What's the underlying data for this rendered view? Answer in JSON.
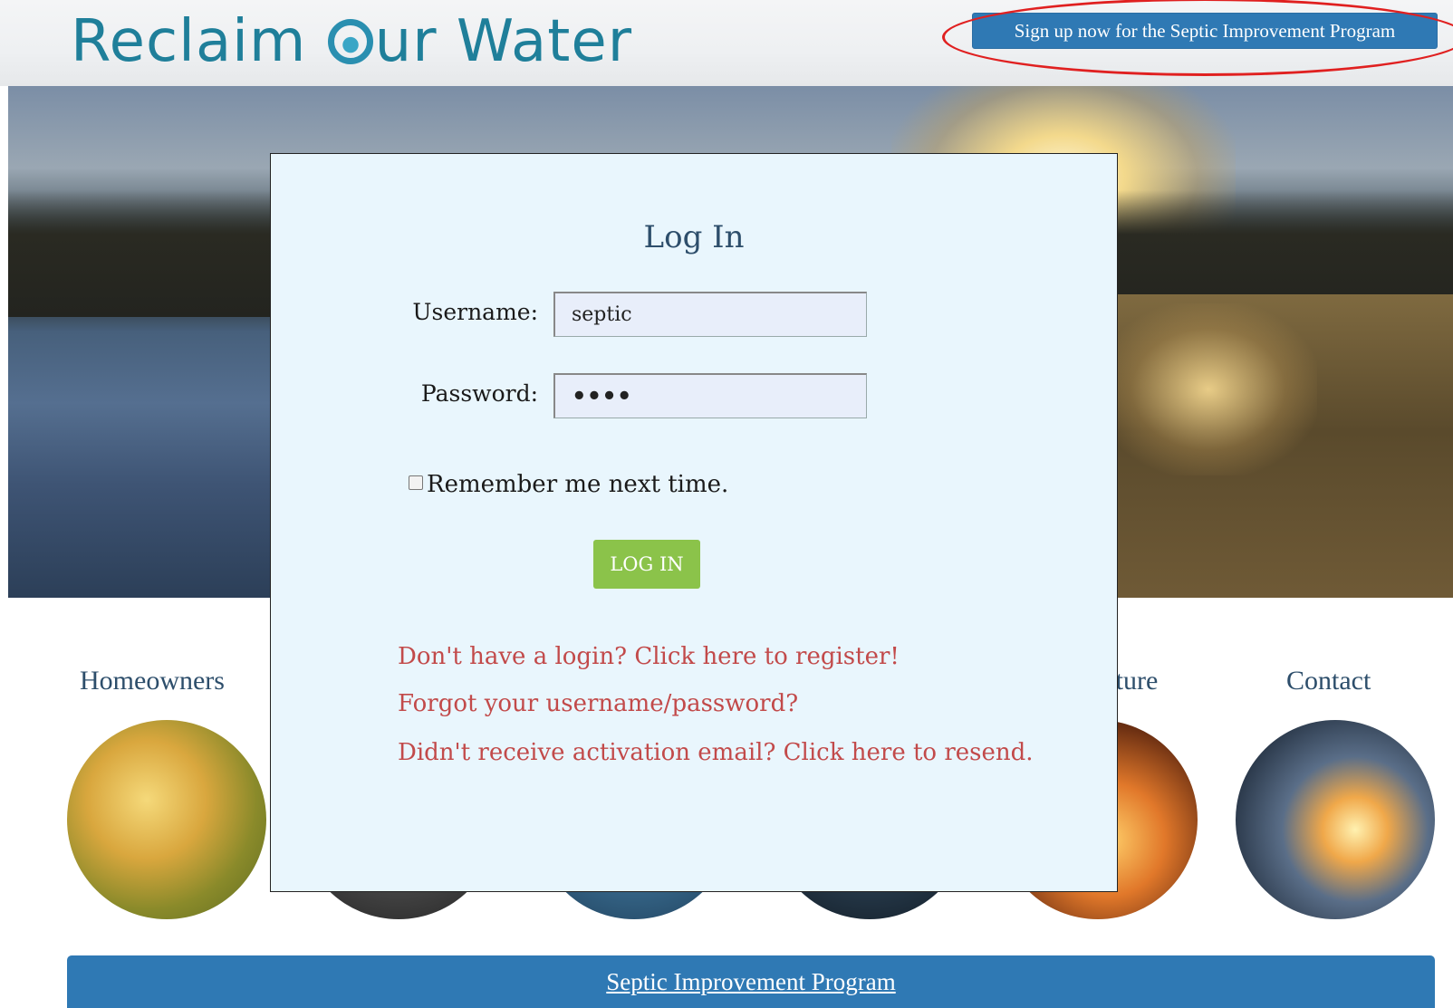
{
  "header": {
    "logo_text_before": "Reclaim",
    "logo_text_after": "ur Water",
    "signup_button": "Sign up now for the Septic Improvement Program"
  },
  "nav": {
    "items": [
      {
        "label": "Homeowners"
      },
      {
        "label": ""
      },
      {
        "label": ""
      },
      {
        "label": ""
      },
      {
        "label": "ıcture"
      },
      {
        "label": "Contact"
      }
    ]
  },
  "footer": {
    "link": "Septic Improvement Program"
  },
  "modal": {
    "title": "Log In",
    "username_label": "Username:",
    "username_value": "septic",
    "password_label": "Password:",
    "password_value": "••••",
    "remember_label": "Remember me next time.",
    "login_button": "LOG IN",
    "links": [
      "Don't have a login? Click here to register!",
      "Forgot your username/password?",
      "Didn't receive activation email? Click here to resend."
    ]
  },
  "colors": {
    "accent_blue": "#2f79b4",
    "login_green": "#8bc34a",
    "link_red": "#c24a4a",
    "highlight_ellipse": "#e02020"
  }
}
